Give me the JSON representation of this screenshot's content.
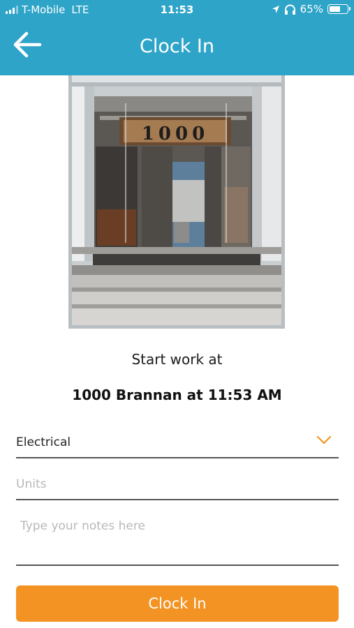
{
  "status_bar": {
    "carrier": "T-Mobile",
    "network": "LTE",
    "time": "11:53",
    "battery_percent": "65%",
    "battery_level": 0.65,
    "signal_bars_active": 3,
    "signal_bars_total": 4
  },
  "nav": {
    "back_icon": "arrow-left-icon",
    "title": "Clock In"
  },
  "photo": {
    "address_sign": "1000"
  },
  "clock_in": {
    "start_label": "Start work at",
    "location_line": "1000 Brannan at 11:53 AM"
  },
  "form": {
    "trade_select": {
      "value": "Electrical",
      "icon": "chevron-down-icon"
    },
    "units": {
      "value": "",
      "placeholder": "Units"
    },
    "notes": {
      "value": "",
      "placeholder": "Type your notes here"
    }
  },
  "actions": {
    "clock_in_label": "Clock In"
  },
  "colors": {
    "header": "#2ea4c8",
    "accent": "#f39323"
  }
}
